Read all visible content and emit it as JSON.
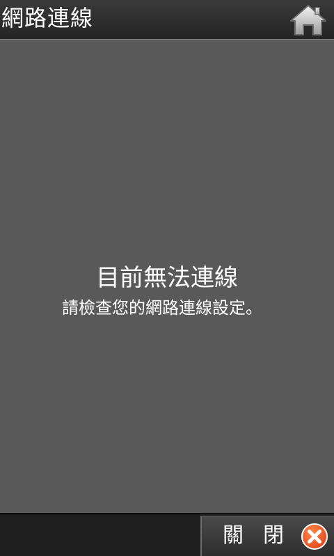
{
  "header": {
    "title": "網路連線",
    "home_icon": "home-icon"
  },
  "message": {
    "title": "目前無法連線",
    "subtitle": "請檢查您的網路連線設定。"
  },
  "footer": {
    "close_label": "關閉",
    "close_icon": "close-circle-icon"
  },
  "colors": {
    "content_bg": "#595959",
    "header_bg": "#2e2e2e",
    "close_icon_bg": "#f05a28",
    "text": "#ffffff"
  }
}
